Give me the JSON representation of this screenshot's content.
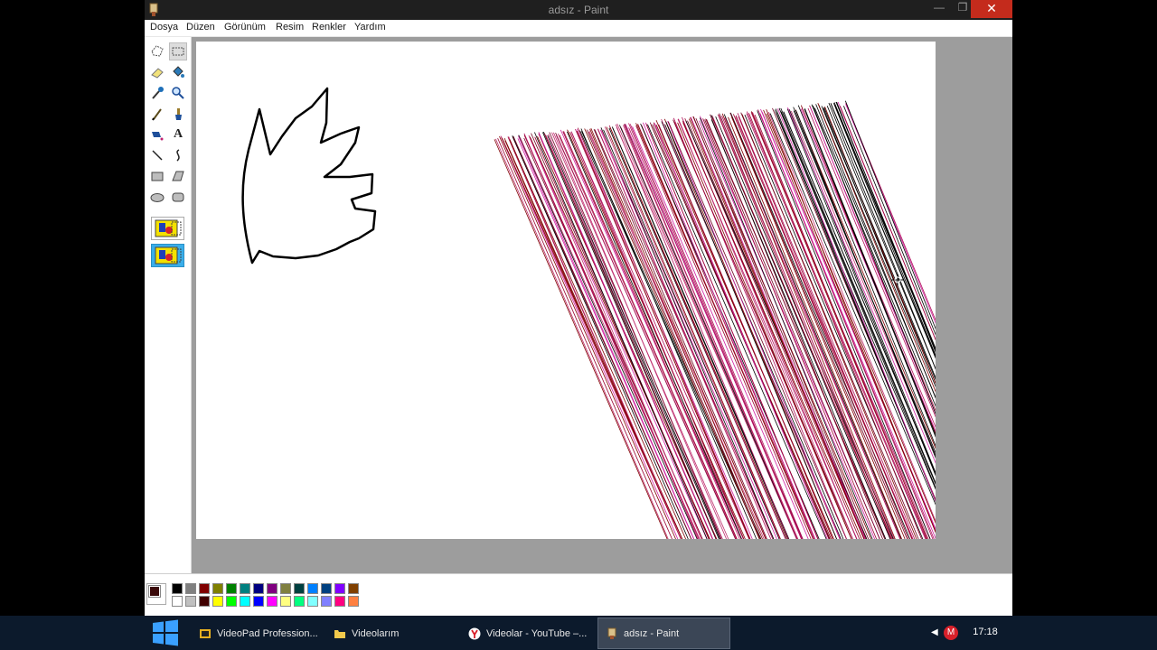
{
  "window": {
    "title": "adsız - Paint",
    "min_label": "—",
    "max_label": "❐",
    "close_label": "✕"
  },
  "menu": [
    {
      "label": "Dosya"
    },
    {
      "label": "Düzen"
    },
    {
      "label": "Görünüm"
    },
    {
      "label": "Resim"
    },
    {
      "label": "Renkler"
    },
    {
      "label": "Yardım"
    }
  ],
  "tools": [
    "free-select-icon",
    "rect-select-icon",
    "eraser-icon",
    "fill-icon",
    "color-picker-icon",
    "magnifier-icon",
    "pencil-icon",
    "brush-icon",
    "airbrush-icon",
    "text-icon",
    "line-icon",
    "curve-icon",
    "rectangle-icon",
    "polygon-icon",
    "ellipse-icon",
    "rounded-rect-icon"
  ],
  "selected_tool": "rect-select-icon",
  "text_tool_glyph": "A",
  "colors": {
    "foreground": "#3a0a0a",
    "background": "#ffffff",
    "palette_row1": [
      "#000000",
      "#808080",
      "#800000",
      "#808000",
      "#008000",
      "#008080",
      "#000080",
      "#800080",
      "#808040",
      "#004040",
      "#0080ff",
      "#004080",
      "#8000ff",
      "#804000"
    ],
    "palette_row2": [
      "#ffffff",
      "#c0c0c0",
      "#400000",
      "#ffff00",
      "#00ff00",
      "#00ffff",
      "#0000ff",
      "#ff00ff",
      "#ffff80",
      "#00ff80",
      "#80ffff",
      "#8080ff",
      "#ff0080",
      "#ff8040"
    ],
    "stroke_colors": [
      "#000000",
      "#800000",
      "#b0105a",
      "#d020a0",
      "#700020",
      "#9a0030",
      "#c03070"
    ]
  },
  "taskbar": {
    "tasks": [
      {
        "label": "VideoPad Profession...",
        "icon": "videopad-icon"
      },
      {
        "label": "Videolarım",
        "icon": "folder-icon"
      },
      {
        "label": "Videolar - YouTube –...",
        "icon": "yandex-browser-icon"
      },
      {
        "label": "adsız - Paint",
        "icon": "paint-icon"
      }
    ],
    "tray_arrow": "◀",
    "tray_badge": "M",
    "clock": "17:18"
  }
}
